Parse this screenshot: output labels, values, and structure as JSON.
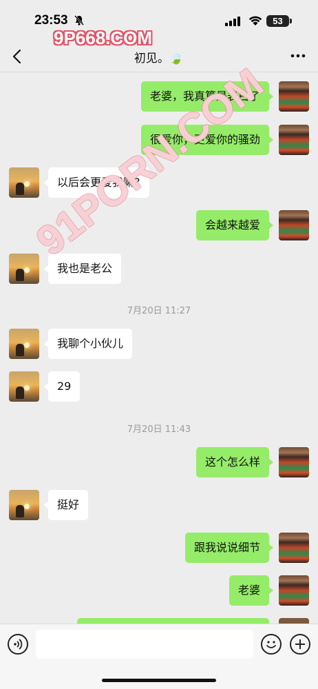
{
  "status_bar": {
    "time": "23:53",
    "battery": "53",
    "icons": [
      "bell-slash-icon",
      "cellular-signal-icon",
      "wifi-icon",
      "battery-icon"
    ]
  },
  "watermark": {
    "top_text": "9P668.COM",
    "diagonal_text": "91PORN.COM"
  },
  "nav": {
    "title": "初见。🍃",
    "back_icon": "chevron-left-icon",
    "more_icon": "more-dots-icon"
  },
  "messages": [
    {
      "side": "self",
      "text": "老婆，我真算是表白了"
    },
    {
      "side": "self",
      "text": "很爱你，更爱你的骚劲"
    },
    {
      "side": "other",
      "text": "以后会更爱我嘛?"
    },
    {
      "side": "self",
      "text": "会越来越爱"
    },
    {
      "side": "other",
      "text": "我也是老公"
    },
    {
      "type": "timestamp",
      "text": "7月20日 11:27"
    },
    {
      "side": "other",
      "text": "我聊个小伙儿"
    },
    {
      "side": "other",
      "text": "29"
    },
    {
      "type": "timestamp",
      "text": "7月20日 11:43"
    },
    {
      "side": "self",
      "text": "这个怎么样"
    },
    {
      "side": "other",
      "text": "挺好"
    },
    {
      "side": "self",
      "text": "跟我说说细节"
    },
    {
      "side": "self",
      "text": "老婆"
    }
  ],
  "input_bar": {
    "value": "",
    "icons": [
      "voice-icon",
      "emoji-icon",
      "plus-icon"
    ]
  },
  "colors": {
    "self_bubble": "#95ec69",
    "other_bubble": "#ffffff",
    "background": "#ededed"
  }
}
